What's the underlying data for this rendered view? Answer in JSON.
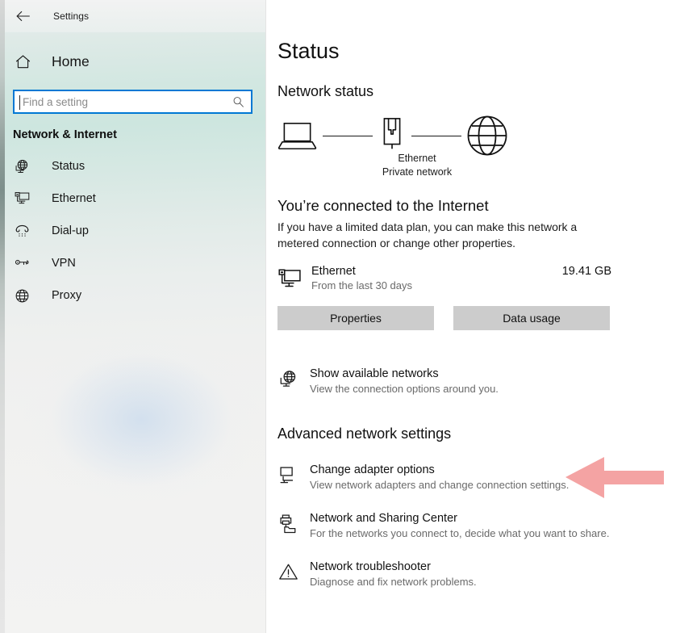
{
  "window": {
    "back_label": "back-arrow",
    "title": "Settings"
  },
  "sidebar": {
    "home_label": "Home",
    "search": {
      "placeholder": "Find a setting",
      "value": "",
      "icon": "search-icon"
    },
    "category": "Network & Internet",
    "items": [
      {
        "label": "Status",
        "icon": "globe-monitor-icon",
        "selected": true
      },
      {
        "label": "Ethernet",
        "icon": "ethernet-monitor-icon",
        "selected": false
      },
      {
        "label": "Dial-up",
        "icon": "telephone-icon",
        "selected": false
      },
      {
        "label": "VPN",
        "icon": "key-icon",
        "selected": false
      },
      {
        "label": "Proxy",
        "icon": "globe-icon",
        "selected": false
      }
    ]
  },
  "main": {
    "page_title": "Status",
    "network_status_heading": "Network status",
    "diagram": {
      "device_icon": "laptop-icon",
      "adapter_icon": "ethernet-port-icon",
      "internet_icon": "globe-icon",
      "caption_line1": "Ethernet",
      "caption_line2": "Private network"
    },
    "connected_title": "You’re connected to the Internet",
    "connected_desc": "If you have a limited data plan, you can make this network a metered connection or change other properties.",
    "adapter": {
      "icon": "ethernet-monitor-icon",
      "name": "Ethernet",
      "sub": "From the last 30 days",
      "usage": "19.41 GB"
    },
    "buttons": {
      "properties": "Properties",
      "data_usage": "Data usage"
    },
    "show_networks": {
      "icon": "globe-monitor-icon",
      "title": "Show available networks",
      "sub": "View the connection options around you."
    },
    "advanced_heading": "Advanced network settings",
    "advanced_links": [
      {
        "icon": "monitor-network-icon",
        "title": "Change adapter options",
        "sub": "View network adapters and change connection settings."
      },
      {
        "icon": "printer-folder-icon",
        "title": "Network and Sharing Center",
        "sub": "For the networks you connect to, decide what you want to share."
      },
      {
        "icon": "warning-triangle-icon",
        "title": "Network troubleshooter",
        "sub": "Diagnose and fix network problems."
      }
    ]
  },
  "annotation": {
    "arrow_color": "#F4A3A3",
    "points_to": "Change adapter options"
  },
  "colors": {
    "accent": "#0078d4",
    "button_bg": "#cccccc",
    "text_primary": "#111111",
    "text_secondary": "#6a6a6a"
  }
}
